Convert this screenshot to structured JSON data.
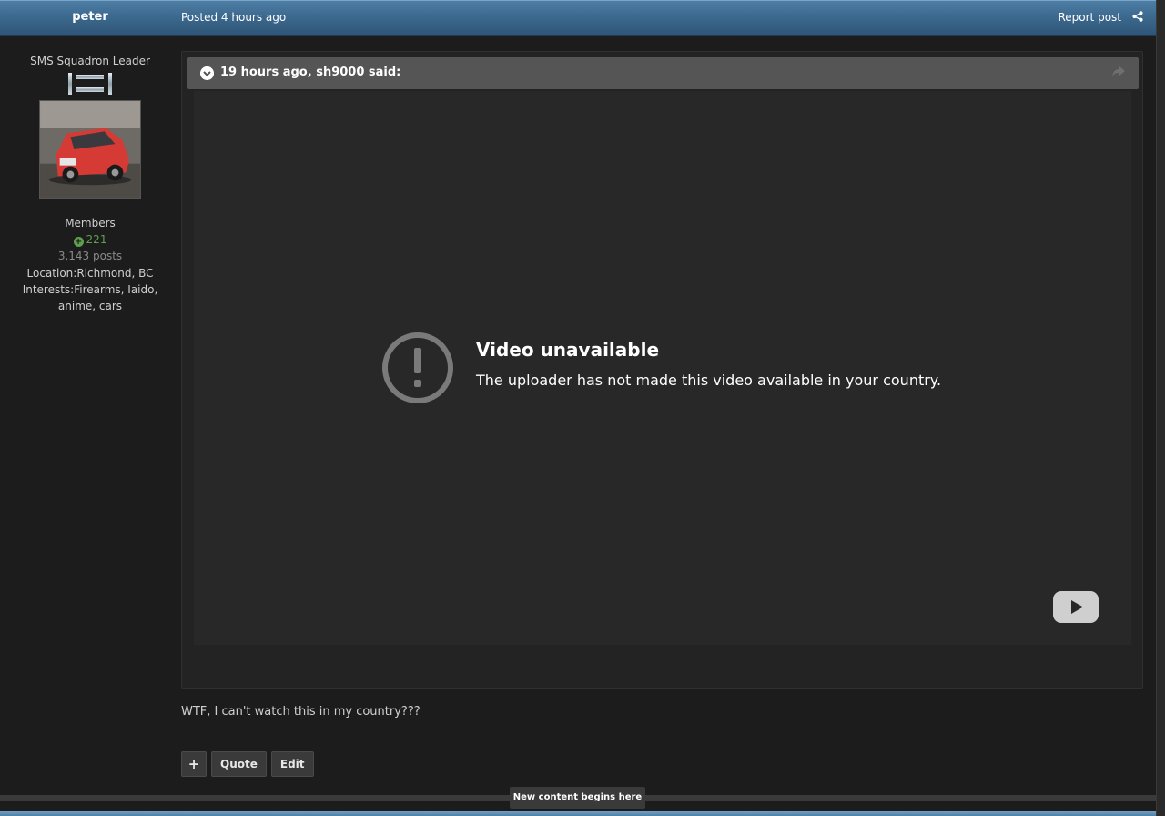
{
  "header": {
    "author": "peter",
    "posted": "Posted 4 hours ago",
    "report_label": "Report post"
  },
  "author_panel": {
    "rank_title": "SMS Squadron Leader",
    "group": "Members",
    "reputation": "221",
    "posts": "3,143 posts",
    "location": "Location:Richmond, BC",
    "interests": "Interests:Firearms, Iaido, anime, cars"
  },
  "quote": {
    "citation": "19 hours ago, sh9000 said:"
  },
  "video": {
    "title": "Video unavailable",
    "message": "The uploader has not made this video available in your country."
  },
  "post": {
    "body": "WTF, I can't watch this in my country???"
  },
  "actions": {
    "plus_label": "+",
    "quote_label": "Quote",
    "edit_label": "Edit"
  },
  "new_content": "New content begins here",
  "colors": {
    "header_blue": "#3d6a90",
    "reputation_green": "#5fa04e",
    "background": "#1c1c1c"
  }
}
